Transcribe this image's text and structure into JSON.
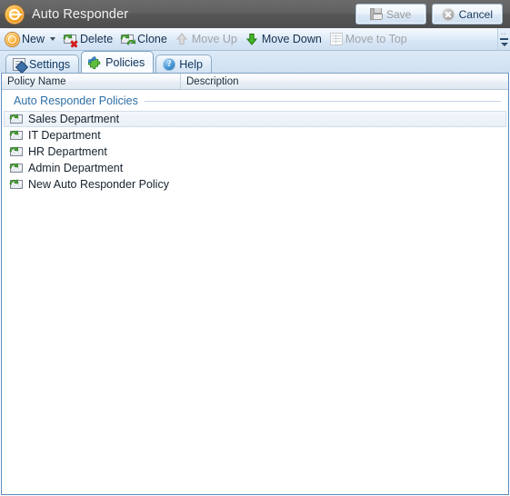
{
  "window": {
    "title": "Auto Responder",
    "title_icon": "auto-responder-circle-icon",
    "accent_color": "#f7a928",
    "titlebar_color": "#5a5a5a",
    "border_color": "#5b8bbf"
  },
  "titlebar_buttons": [
    {
      "label": "Save",
      "icon": "floppy-disk-icon",
      "enabled": false
    },
    {
      "label": "Cancel",
      "icon": "circle-x-icon",
      "enabled": true
    }
  ],
  "toolbar": {
    "items": [
      {
        "label": "New",
        "icon": "new-circle-icon",
        "enabled": true,
        "has_dropdown": true
      },
      {
        "label": "Delete",
        "icon": "delete-policy-icon",
        "enabled": true,
        "has_dropdown": false
      },
      {
        "label": "Clone",
        "icon": "clone-policy-icon",
        "enabled": true,
        "has_dropdown": false
      },
      {
        "label": "Move Up",
        "icon": "arrow-up-icon",
        "enabled": false,
        "has_dropdown": false
      },
      {
        "label": "Move Down",
        "icon": "arrow-down-icon",
        "enabled": true,
        "has_dropdown": false
      },
      {
        "label": "Move to Top",
        "icon": "move-to-top-icon",
        "enabled": false,
        "has_dropdown": false
      }
    ],
    "overflow_icon": "toolbar-overflow-chevron-icon"
  },
  "tabs": [
    {
      "label": "Settings",
      "icon": "settings-document-icon",
      "active": false
    },
    {
      "label": "Policies",
      "icon": "puzzle-piece-icon",
      "active": true
    },
    {
      "label": "Help",
      "icon": "help-question-icon",
      "active": false
    }
  ],
  "table": {
    "columns": [
      {
        "label": "Policy Name"
      },
      {
        "label": "Description"
      }
    ],
    "group_label": "Auto Responder Policies",
    "group_text_color": "#2d6ea5",
    "rows": [
      {
        "name": "Sales Department",
        "description": "",
        "icon": "auto-responder-policy-icon",
        "selected": true
      },
      {
        "name": "IT Department",
        "description": "",
        "icon": "auto-responder-policy-icon",
        "selected": false
      },
      {
        "name": "HR Department",
        "description": "",
        "icon": "auto-responder-policy-icon",
        "selected": false
      },
      {
        "name": "Admin Department",
        "description": "",
        "icon": "auto-responder-policy-icon",
        "selected": false
      },
      {
        "name": "New Auto Responder Policy",
        "description": "",
        "icon": "auto-responder-policy-icon",
        "selected": false
      }
    ]
  }
}
